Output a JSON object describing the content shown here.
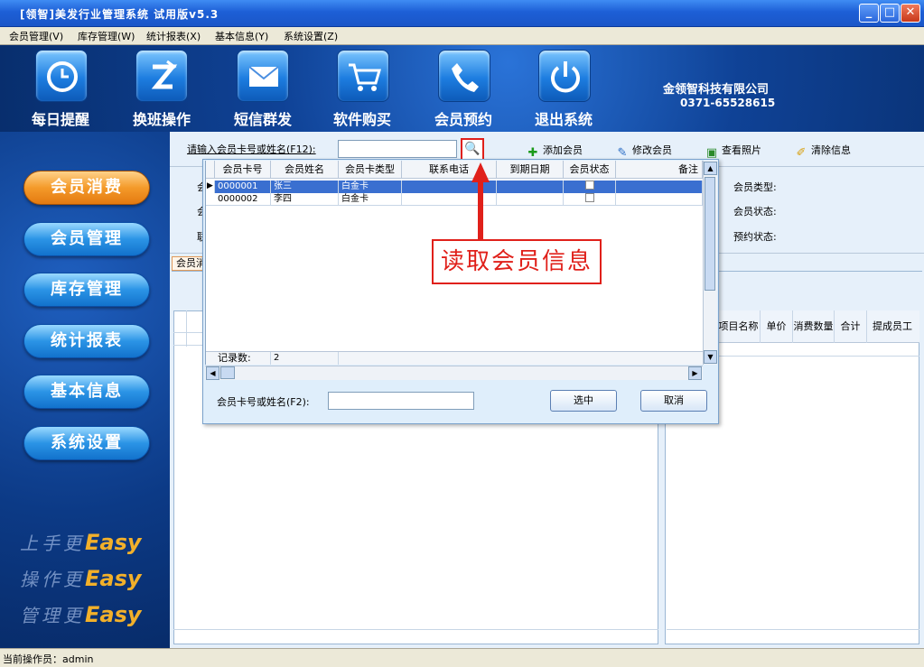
{
  "window": {
    "title": "[领智]美发行业管理系统 试用版v5.3"
  },
  "menu": [
    "会员管理(V)",
    "库存管理(W)",
    "统计报表(X)",
    "基本信息(Y)",
    "系统设置(Z)"
  ],
  "toolbar": [
    {
      "label": "每日提醒",
      "icon": "clock-icon"
    },
    {
      "label": "换班操作",
      "icon": "shift-icon"
    },
    {
      "label": "短信群发",
      "icon": "envelope-icon"
    },
    {
      "label": "软件购买",
      "icon": "cart-icon"
    },
    {
      "label": "会员预约",
      "icon": "phone-icon"
    },
    {
      "label": "退出系统",
      "icon": "power-icon"
    }
  ],
  "company": {
    "name": "金领智科技有限公司",
    "phone": "0371-65528615"
  },
  "sidebar": {
    "items": [
      "会员消费",
      "会员管理",
      "库存管理",
      "统计报表",
      "基本信息",
      "系统设置"
    ],
    "active": "会员消费"
  },
  "slogans": [
    {
      "prefix": "上手更",
      "word": "Easy"
    },
    {
      "prefix": "操作更",
      "word": "Easy"
    },
    {
      "prefix": "管理更",
      "word": "Easy"
    }
  ],
  "search": {
    "label": "请输入会员卡号或姓名(F12):",
    "value": ""
  },
  "actions": [
    "添加会员",
    "修改会员",
    "查看照片",
    "清除信息"
  ],
  "fields_right": [
    "会员类型:",
    "会员状态:",
    "预约状态:"
  ],
  "tab_fragment": "会员消",
  "right_table": {
    "headers": [
      "项目名称",
      "单价",
      "消费数量",
      "合计",
      "提成员工"
    ]
  },
  "popup": {
    "columns": [
      "会员卡号",
      "会员姓名",
      "会员卡类型",
      "联系电话",
      "到期日期",
      "会员状态",
      "备注"
    ],
    "rows": [
      {
        "card": "0000001",
        "name": "张三",
        "type": "白金卡",
        "phone": "",
        "expire": "",
        "status": false,
        "note": ""
      },
      {
        "card": "0000002",
        "name": "李四",
        "type": "白金卡",
        "phone": "",
        "expire": "",
        "status": false,
        "note": ""
      }
    ],
    "record_label": "记录数:",
    "record_count": "2",
    "filter_label": "会员卡号或姓名(F2):",
    "filter_value": "",
    "select_button": "选中",
    "cancel_button": "取消"
  },
  "annotation": "读取会员信息",
  "status": {
    "operator": "当前操作员：admin"
  },
  "colors": {
    "accent": "#e0201a",
    "active_tab": "#f49a2a",
    "sidebar_button": "#2b94e6"
  }
}
